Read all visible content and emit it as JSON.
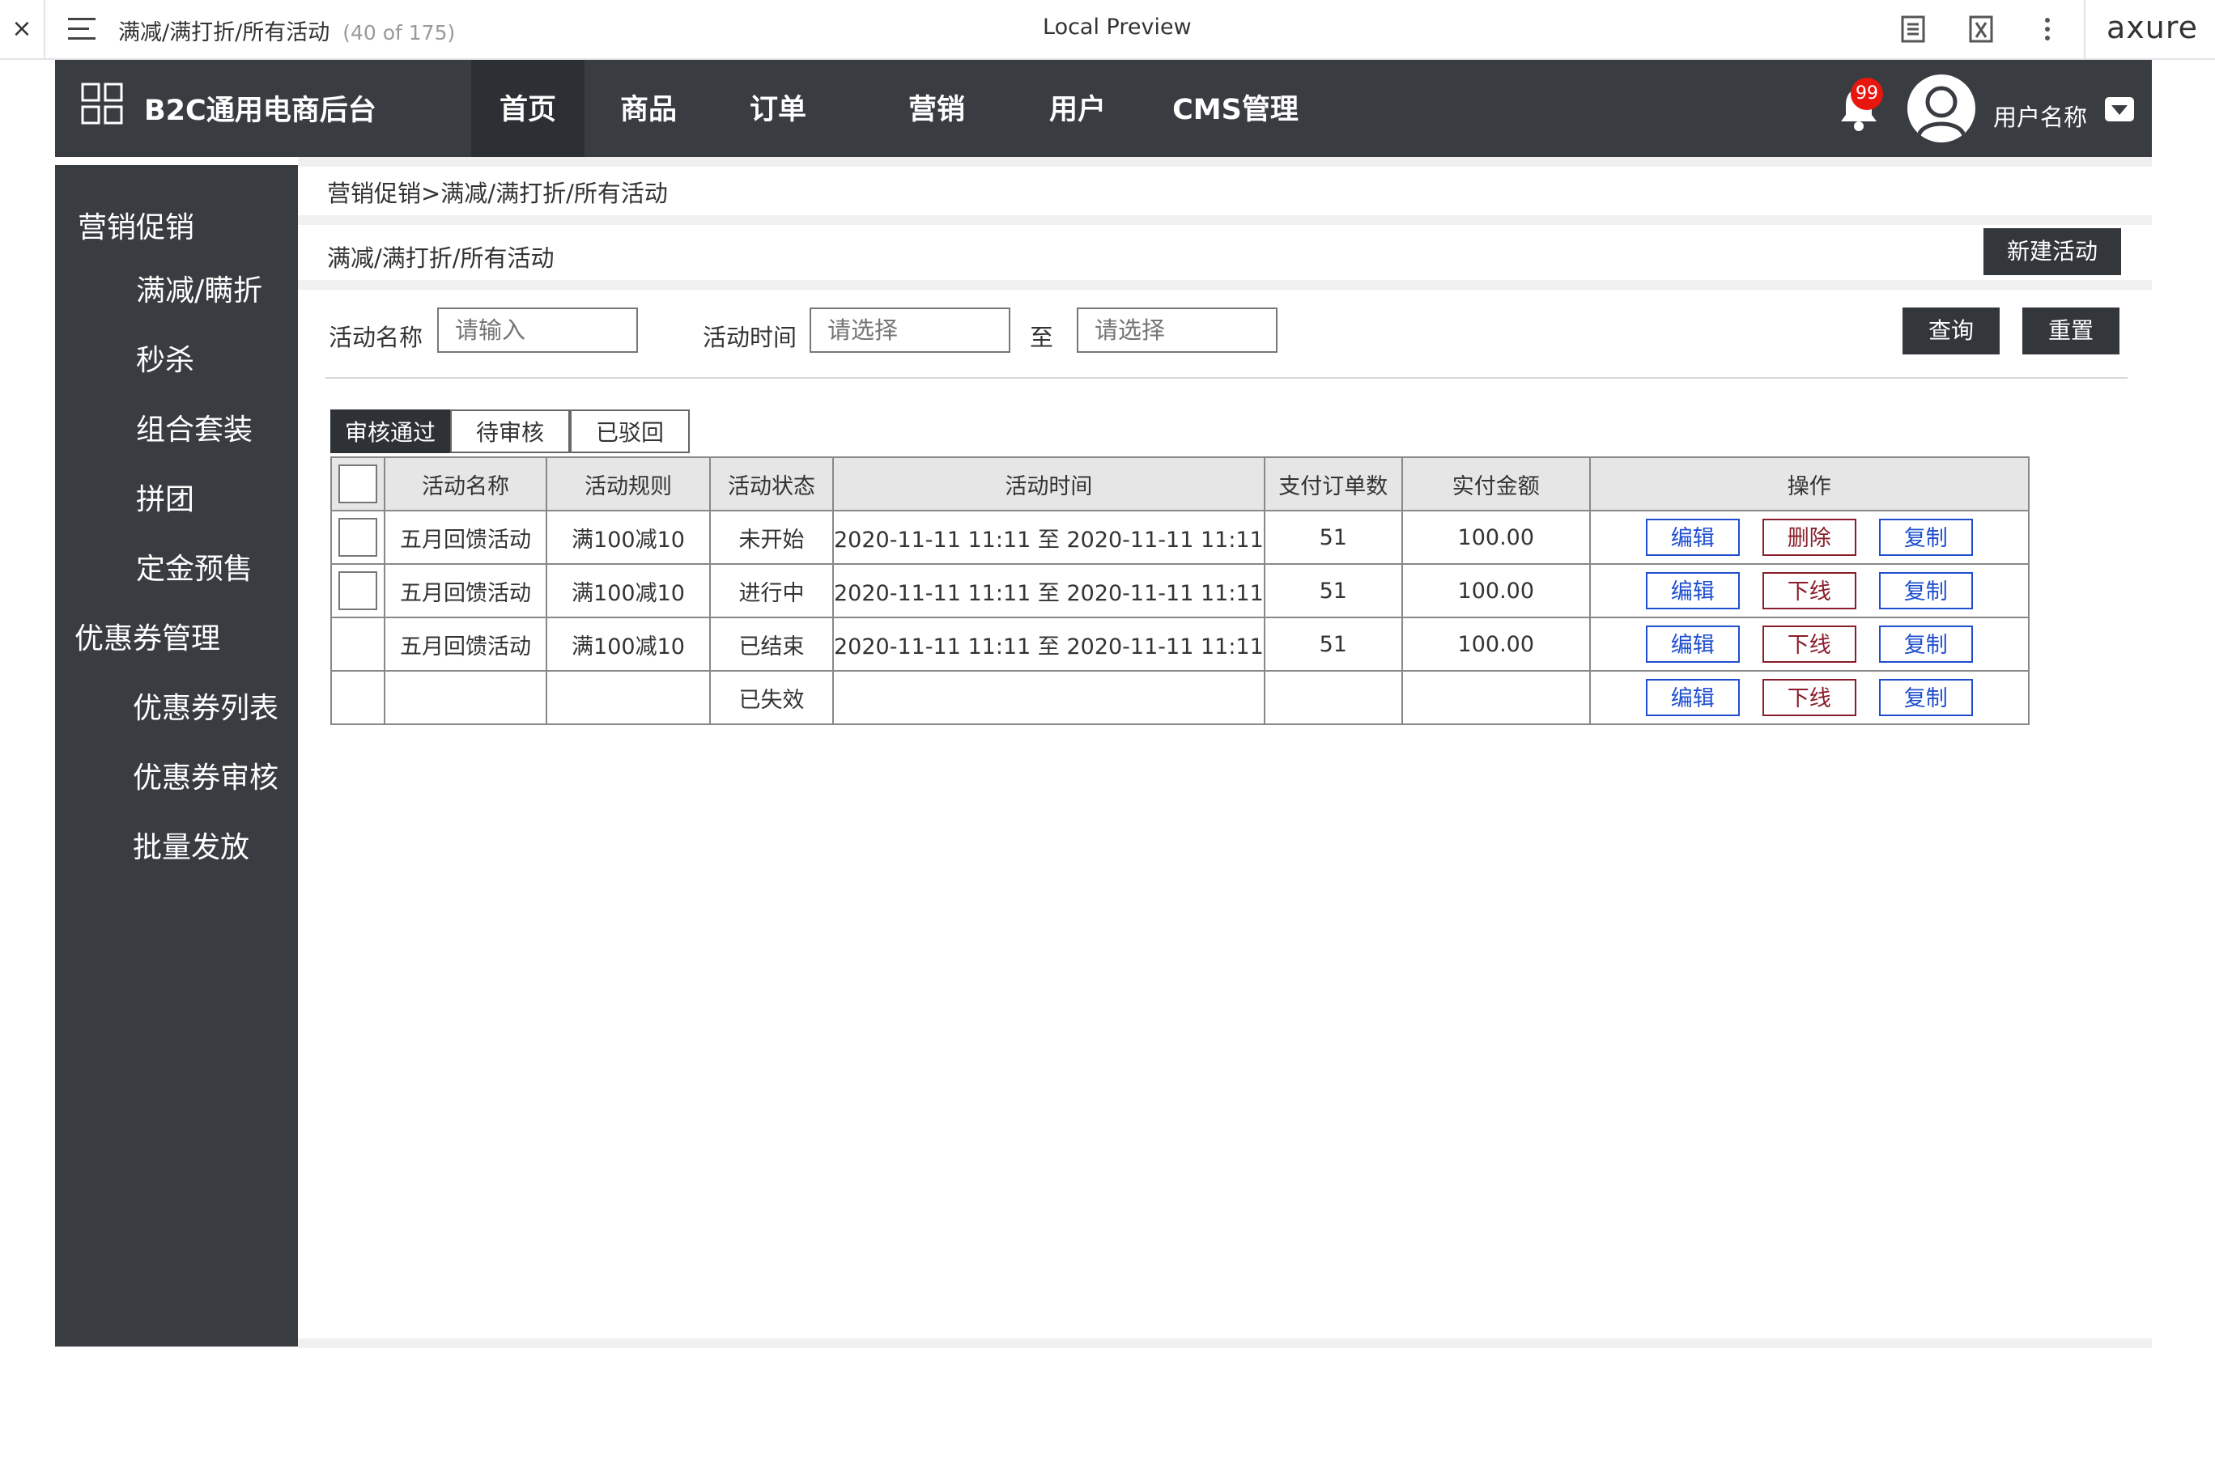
{
  "axure_bar": {
    "close": "×",
    "page_title": "满减/满打折/所有活动",
    "page_count": "(40 of 175)",
    "preview_label": "Local Preview",
    "logo": "axure"
  },
  "header": {
    "app_name": "B2C通用电商后台",
    "nav": [
      "首页",
      "商品",
      "订单",
      "营销",
      "用户",
      "CMS管理"
    ],
    "active_nav": "首页",
    "badge_count": "99",
    "username": "用户名称"
  },
  "sidebar": {
    "groups": [
      {
        "title": "营销促销",
        "items": [
          "满减/瞒折",
          "秒杀",
          "组合套装",
          "拼团",
          "定金预售"
        ]
      },
      {
        "title": "优惠券管理",
        "items": [
          "优惠券列表",
          "优惠券审核",
          "批量发放"
        ]
      }
    ]
  },
  "content": {
    "breadcrumb": "营销促销>满减/满打折/所有活动",
    "section_title": "满减/满打折/所有活动",
    "new_button": "新建活动",
    "filters": {
      "name_label": "活动名称",
      "name_placeholder": "请输入",
      "time_label": "活动时间",
      "start_placeholder": "请选择",
      "to_label": "至",
      "end_placeholder": "请选择",
      "query_button": "查询",
      "reset_button": "重置"
    },
    "tabs": [
      "审核通过",
      "待审核",
      "已驳回"
    ],
    "active_tab": "审核通过",
    "table": {
      "columns": [
        "",
        "活动名称",
        "活动规则",
        "活动状态",
        "活动时间",
        "支付订单数",
        "实付金额",
        "操作"
      ],
      "rows": [
        {
          "checkbox": true,
          "name": "五月回馈活动",
          "rule": "满100减10",
          "status": "未开始",
          "time": "2020-11-11 11:11 至 2020-11-11 11:11",
          "orders": "51",
          "amount": "100.00",
          "actions": [
            "编辑",
            "删除",
            "复制"
          ]
        },
        {
          "checkbox": true,
          "name": "五月回馈活动",
          "rule": "满100减10",
          "status": "进行中",
          "time": "2020-11-11 11:11 至 2020-11-11 11:11",
          "orders": "51",
          "amount": "100.00",
          "actions": [
            "编辑",
            "下线",
            "复制"
          ]
        },
        {
          "checkbox": false,
          "name": "五月回馈活动",
          "rule": "满100减10",
          "status": "已结束",
          "time": "2020-11-11 11:11 至 2020-11-11 11:11",
          "orders": "51",
          "amount": "100.00",
          "actions": [
            "编辑",
            "下线",
            "复制"
          ]
        },
        {
          "checkbox": false,
          "name": "",
          "rule": "",
          "status": "已失效",
          "time": "",
          "orders": "",
          "amount": "",
          "actions": [
            "编辑",
            "下线",
            "复制"
          ]
        }
      ]
    }
  },
  "colors": {
    "header_bg": "#393d42",
    "sidebar_bg": "#393d42",
    "active_nav_bg": "#2c2f33",
    "badge": "#e8160c",
    "action_blue": "#1f4fcf",
    "action_red": "#8a1d2b"
  }
}
